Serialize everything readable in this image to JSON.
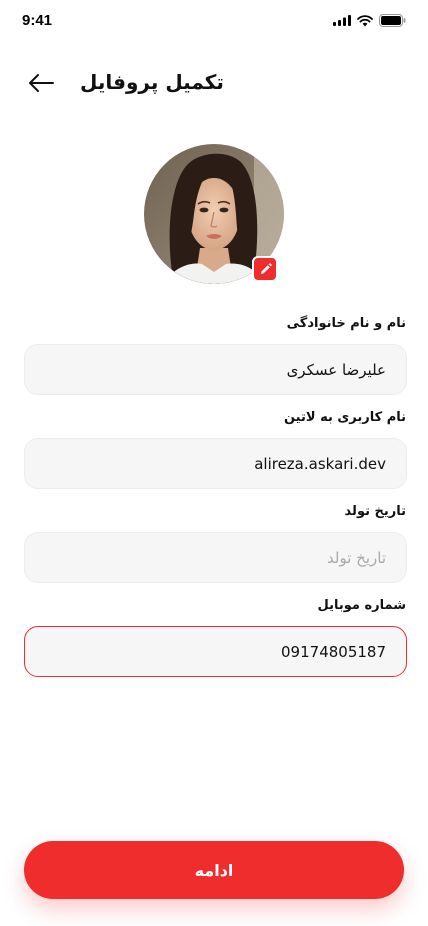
{
  "status_bar": {
    "time": "9:41"
  },
  "header": {
    "title": "تکمیل پروفایل"
  },
  "profile": {
    "avatar_alt": "avatar"
  },
  "form": {
    "full_name": {
      "label": "نام و نام خانوادگی",
      "value": "علیرضا عسکری",
      "placeholder": ""
    },
    "username": {
      "label": "نام کاربری به لاتین",
      "value": "alireza.askari.dev",
      "placeholder": ""
    },
    "birth_date": {
      "label": "تاریخ تولد",
      "value": "",
      "placeholder": "تاریخ تولد"
    },
    "mobile": {
      "label": "شماره موبایل",
      "value": "09174805187",
      "placeholder": ""
    }
  },
  "actions": {
    "continue_label": "ادامه"
  },
  "colors": {
    "accent": "#ef2d2d",
    "field_bg": "#f6f6f6",
    "text": "#111111"
  }
}
